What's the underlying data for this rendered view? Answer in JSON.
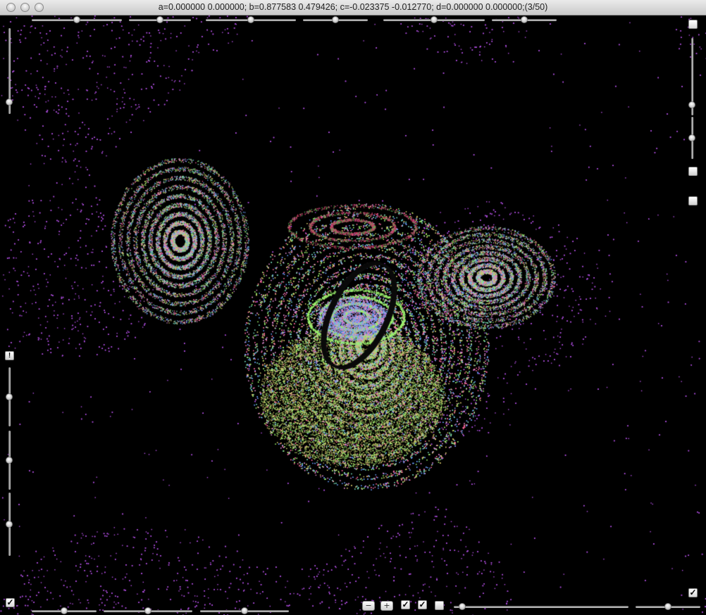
{
  "window": {
    "title": "a=0.000000 0.000000; b=0.877583 0.479426; c=-0.023375 -0.012770; d=0.000000 0.000000;(3/50)",
    "background_color": "#000000"
  },
  "visualization": {
    "type": "particle-attractor-render",
    "colors": [
      "#b450e6",
      "#9cf26e",
      "#e08bd0",
      "#6aa0ff",
      "#d7c86a",
      "#ff6aa0",
      "#7ae0c0",
      "#1a1a1a"
    ]
  },
  "controls": {
    "top_sliders": [
      {
        "value": 0.5
      },
      {
        "value": 0.5
      },
      {
        "value": 0.5
      },
      {
        "value": 0.5
      },
      {
        "value": 0.5
      },
      {
        "value": 0.5
      }
    ],
    "left_sliders": [
      {
        "value": 0.86
      },
      {
        "value": 0.5
      },
      {
        "value": 0.5
      },
      {
        "value": 0.5
      }
    ],
    "right_sliders": [
      {
        "value": 0.86
      },
      {
        "value": 0.5
      }
    ],
    "bottom_left_sliders": [
      {
        "value": 0.5
      },
      {
        "value": 0.5
      },
      {
        "value": 0.5
      }
    ],
    "bottom_right_sliders": [
      {
        "value": 0.05
      },
      {
        "value": 0.5
      }
    ],
    "buttons": {
      "minus_label": "−",
      "plus_label": "+",
      "info_label": "!"
    },
    "checkbox_checked_glyph": "✓",
    "checkboxes": [
      {
        "checked": true
      },
      {
        "checked": true
      },
      {
        "checked": false
      },
      {
        "checked": true
      },
      {
        "checked": true
      }
    ]
  }
}
